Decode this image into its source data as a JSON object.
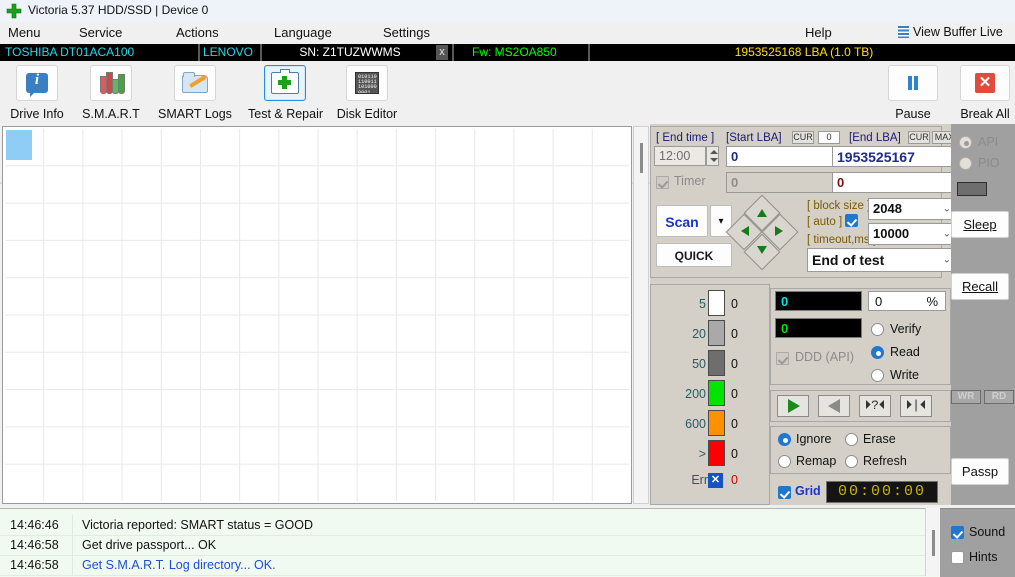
{
  "window": {
    "title": "Victoria 5.37 HDD/SSD | Device 0",
    "icon": "green-cross-icon",
    "minimize": "—",
    "maximize": "□",
    "close": "✕"
  },
  "menu": {
    "items": [
      {
        "label": "Menu"
      },
      {
        "label": "Service"
      },
      {
        "label": "Actions"
      },
      {
        "label": "Language"
      },
      {
        "label": "Settings"
      },
      {
        "label": "Help"
      }
    ],
    "view_buffer_live": "View Buffer Live"
  },
  "drive_info": {
    "model": "TOSHIBA DT01ACA100",
    "vendor": "LENOVO",
    "serial": "SN: Z1TUZWWMS",
    "close_x": "x",
    "firmware": "Fw: MS2OA850",
    "capacity": "1953525168 LBA (1.0 TB)"
  },
  "toolbar": {
    "buttons": [
      {
        "label": "Drive Info",
        "icon": "info-icon",
        "selected": false
      },
      {
        "label": "S.M.A.R.T",
        "icon": "test-tubes-icon",
        "selected": false
      },
      {
        "label": "SMART Logs",
        "icon": "folder-pencil-icon",
        "selected": false
      },
      {
        "label": "Test & Repair",
        "icon": "first-aid-kit-icon",
        "selected": true
      },
      {
        "label": "Disk Editor",
        "icon": "binary-page-icon",
        "selected": false
      }
    ],
    "right_buttons": [
      {
        "label": "Pause",
        "icon": "pause-icon"
      },
      {
        "label": "Break All",
        "icon": "red-x-icon"
      }
    ],
    "binary_art": "010110 110011 101000 0001"
  },
  "test_params": {
    "end_time_label": "[ End time ]",
    "end_time_value": "12:00",
    "timer_label": "Timer",
    "timer_checked": true,
    "start_lba_label": "[Start LBA]",
    "start_lba_cur": "CUR",
    "start_lba_zero": "0",
    "start_lba_value": "0",
    "start_lba_second": "0",
    "end_lba_label": "[End LBA]",
    "end_lba_cur": "CUR",
    "end_lba_max": "MAX",
    "end_lba_value": "1953525167",
    "end_lba_second": "0",
    "scan_button": "Scan",
    "scan_dropdown": "▾",
    "quick_button": "QUICK",
    "block_size_label": "[ block size ]",
    "block_size_value": "2048",
    "auto_label": "[ auto ]",
    "auto_checked": true,
    "timeout_label": "[ timeout,ms ]",
    "timeout_value": "10000",
    "end_of_test_value": "End of test"
  },
  "legend": {
    "rows": [
      {
        "threshold": "5",
        "color": "#ffffff",
        "count": "0"
      },
      {
        "threshold": "20",
        "color": "#a9a9a9",
        "count": "0"
      },
      {
        "threshold": "50",
        "color": "#6e6e6e",
        "count": "0"
      },
      {
        "threshold": "200",
        "color": "#00e500",
        "count": "0"
      },
      {
        "threshold": "600",
        "color": "#ff9000",
        "count": "0"
      },
      {
        "threshold": ">",
        "color": "#ff0000",
        "count": "0"
      }
    ],
    "error_label": "Err",
    "error_icon": "blue-x-badge-icon",
    "error_count": "0"
  },
  "progress": {
    "speed_value": "0",
    "speed_color": "#00e5e5",
    "percent_value": "0",
    "percent_sign": "%",
    "blocks_value": "0",
    "blocks_color": "#00e500",
    "ddd_api_label": "DDD (API)",
    "ddd_api_checked": false
  },
  "mode": {
    "options": [
      {
        "label": "Verify",
        "selected": false
      },
      {
        "label": "Read",
        "selected": true
      },
      {
        "label": "Write",
        "selected": false
      }
    ]
  },
  "transport": {
    "buttons": [
      {
        "name": "play",
        "glyph": "▶"
      },
      {
        "name": "reverse",
        "glyph": "◀"
      },
      {
        "name": "random",
        "glyph": "⏵?⏴"
      },
      {
        "name": "end",
        "glyph": "⏵|⏴"
      }
    ]
  },
  "defects": {
    "options": [
      {
        "label": "Ignore",
        "selected": true
      },
      {
        "label": "Erase",
        "selected": false
      },
      {
        "label": "Remap",
        "selected": false
      },
      {
        "label": "Refresh",
        "selected": false
      }
    ]
  },
  "footer_controls": {
    "grid_label": "Grid",
    "grid_checked": true,
    "clock": "00:00:00"
  },
  "side_panel": {
    "api_label": "API",
    "api_selected": true,
    "pio_label": "PIO",
    "pio_selected": false,
    "sleep_label": "Sleep",
    "recall_label": "Recall",
    "wr_label": "WR",
    "rd_label": "RD",
    "passp_label": "Passp"
  },
  "log": {
    "rows": [
      {
        "time": "14:46:46",
        "message": "Victoria reported: SMART status = GOOD",
        "color": "#111111"
      },
      {
        "time": "14:46:58",
        "message": "Get drive passport... OK",
        "color": "#111111"
      },
      {
        "time": "14:46:58",
        "message": "Get S.M.A.R.T. Log directory... OK.",
        "color": "#1a4fd0"
      }
    ]
  },
  "bottom_options": {
    "sound_label": "Sound",
    "sound_checked": true,
    "hints_label": "Hints",
    "hints_checked": false
  },
  "colors": {
    "accent": "#1f77d0",
    "panel": "#d4d0c8",
    "strip": "#a0a0a0"
  }
}
